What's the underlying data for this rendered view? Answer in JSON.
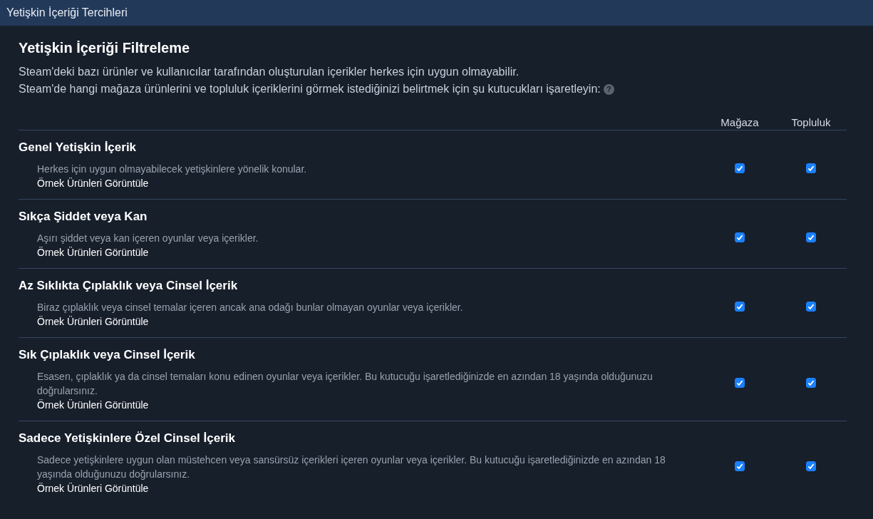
{
  "window": {
    "title": "Yetişkin İçeriği Tercihleri"
  },
  "heading": "Yetişkin İçeriği Filtreleme",
  "intro": [
    "Steam'deki bazı ürünler ve kullanıcılar tarafından oluşturulan içerikler herkes için uygun olmayabilir.",
    "Steam'de hangi mağaza ürünlerini ve topluluk içeriklerini görmek istediğinizi belirtmek için şu kutucukları işaretleyin:"
  ],
  "help": "?",
  "columns": [
    "Mağaza",
    "Topluluk"
  ],
  "rows": [
    {
      "title": "Genel Yetişkin İçerik",
      "description": "Herkes için uygun olmayabilecek yetişkinlere yönelik konular.",
      "link": "Örnek Ürünleri Görüntüle",
      "store_checked": true,
      "community_checked": true
    },
    {
      "title": "Sıkça Şiddet veya Kan",
      "description": "Aşırı şiddet veya kan içeren oyunlar veya içerikler.",
      "link": "Örnek Ürünleri Görüntüle",
      "store_checked": true,
      "community_checked": true
    },
    {
      "title": "Az Sıklıkta Çıplaklık veya Cinsel İçerik",
      "description": "Biraz çıplaklık veya cinsel temalar içeren ancak ana odağı bunlar olmayan oyunlar veya içerikler.",
      "link": "Örnek Ürünleri Görüntüle",
      "store_checked": true,
      "community_checked": true
    },
    {
      "title": "Sık Çıplaklık veya Cinsel İçerik",
      "description": "Esasen, çıplaklık ya da cinsel temaları konu edinen oyunlar veya içerikler. Bu kutucuğu işaretlediğinizde en azından 18 yaşında olduğunuzu doğrularsınız.",
      "link": "Örnek Ürünleri Görüntüle",
      "store_checked": true,
      "community_checked": true
    },
    {
      "title": "Sadece Yetişkinlere Özel Cinsel İçerik",
      "description": "Sadece yetişkinlere uygun olan müstehcen veya sansürsüz içerikleri içeren oyunlar veya içerikler. Bu kutucuğu işaretlediğinizde en azından 18 yaşında olduğunuzu doğrularsınız.",
      "link": "Örnek Ürünleri Görüntüle",
      "store_checked": true,
      "community_checked": true
    }
  ]
}
